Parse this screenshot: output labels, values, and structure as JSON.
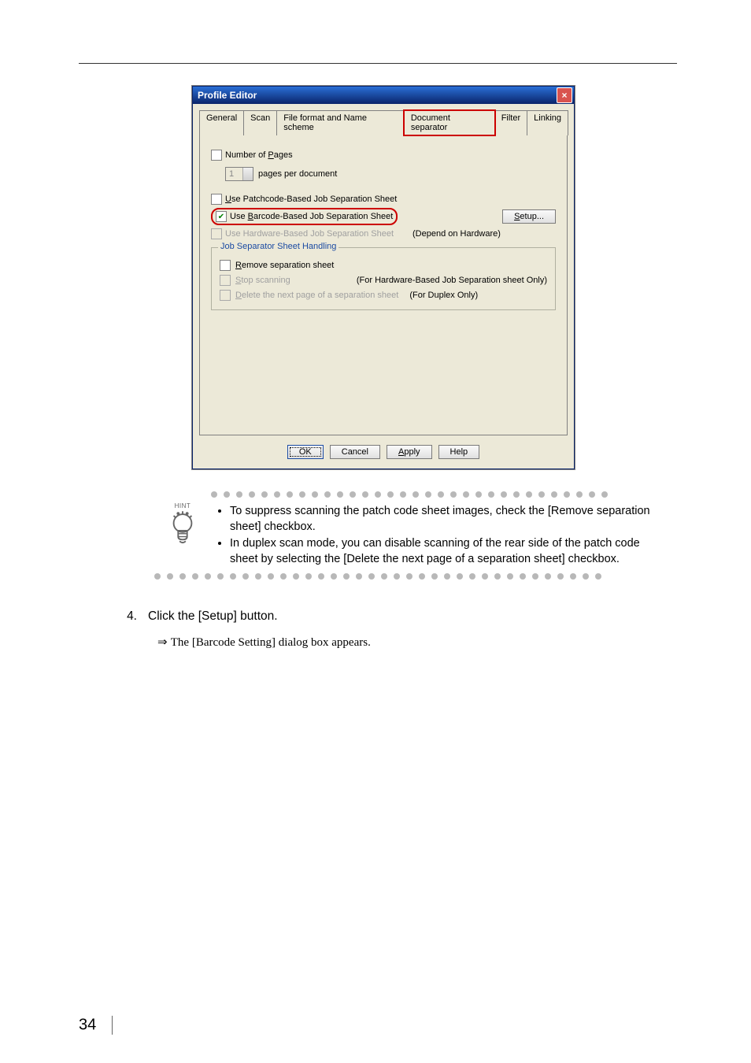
{
  "dialog": {
    "title": "Profile Editor",
    "tabs": {
      "general": "General",
      "scan": "Scan",
      "file_format": "File format and Name scheme",
      "document_separator": "Document separator",
      "filter": "Filter",
      "linking": "Linking"
    },
    "pages": {
      "number_of_pages_label": "Number of Pages",
      "spinner_value": "1",
      "pages_per_document": "pages per document"
    },
    "sep": {
      "use_patchcode": "Use Patchcode-Based Job Separation Sheet",
      "use_barcode": "Use Barcode-Based Job Separation Sheet",
      "use_hardware": "Use Hardware-Based Job Separation Sheet",
      "depend_hw": "(Depend on Hardware)",
      "setup_btn": "Setup..."
    },
    "group": {
      "title": "Job Separator Sheet Handling",
      "remove_sep": "Remove separation sheet",
      "stop_scanning": "Stop scanning",
      "stop_note": "(For Hardware-Based Job Separation sheet Only)",
      "delete_next": "Delete the next page of a separation sheet",
      "delete_note": "(For Duplex Only)"
    },
    "buttons": {
      "ok": "OK",
      "cancel": "Cancel",
      "apply": "Apply",
      "help": "Help"
    }
  },
  "hint": {
    "label": "HINT",
    "b1": "To suppress scanning the patch code sheet images, check the [Remove separation sheet] checkbox.",
    "b2": "In duplex scan mode, you can disable scanning of the rear side of the patch code sheet by selecting the [Delete the next page of a separation sheet] checkbox."
  },
  "step": {
    "num": "4.",
    "text": "Click the [Setup] button.",
    "result_prefix": "⇒ ",
    "result": "The [Barcode Setting] dialog box appears."
  },
  "page_number": "34"
}
